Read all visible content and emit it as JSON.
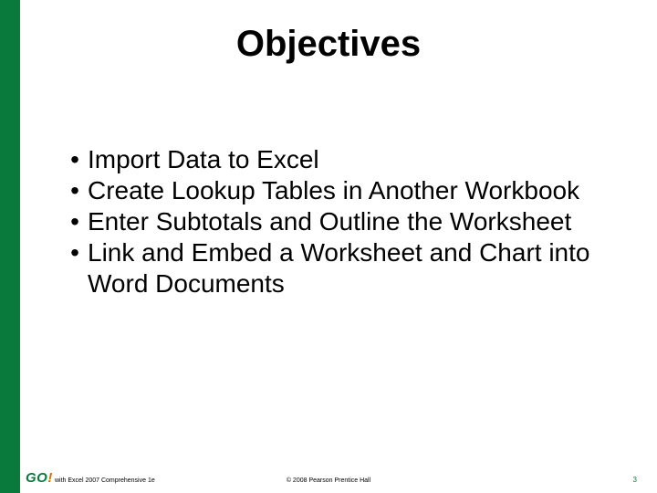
{
  "title": "Objectives",
  "bullets": [
    "Import Data to Excel",
    "Create Lookup Tables in Another Workbook",
    "Enter Subtotals and Outline the Worksheet",
    "Link and Embed a Worksheet and Chart into Word Documents"
  ],
  "logo": {
    "main": "GO",
    "exclaim": "!"
  },
  "footer": {
    "left": "with Excel 2007 Comprehensive 1e",
    "center": "© 2008 Pearson Prentice Hall",
    "page": "3"
  }
}
